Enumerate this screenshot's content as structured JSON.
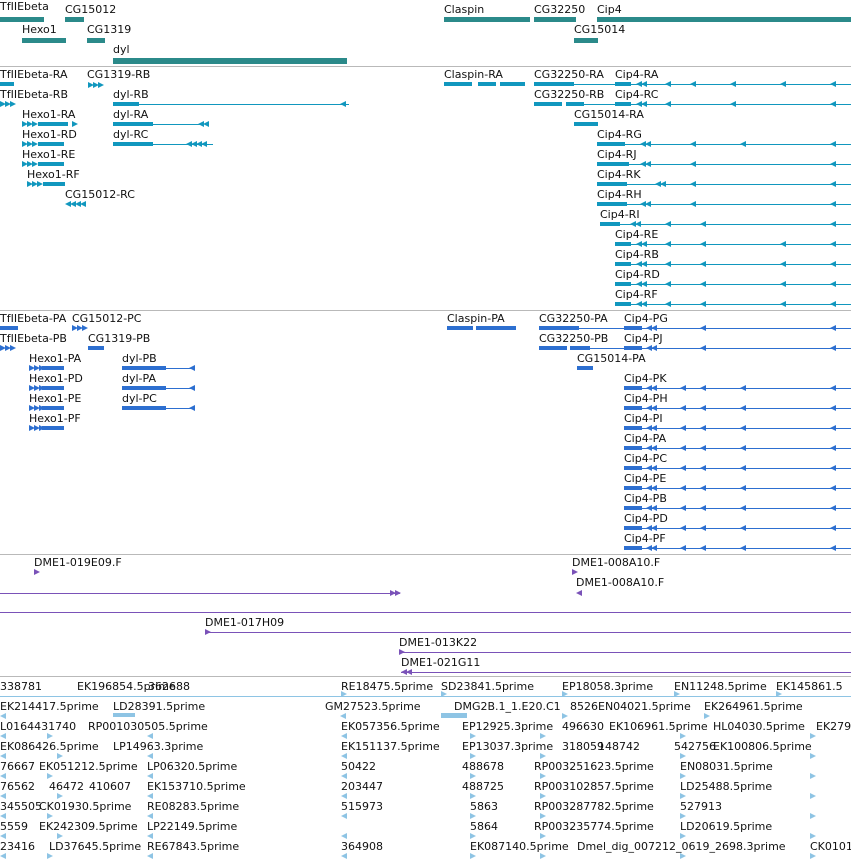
{
  "colors": {
    "gene": "#2b8a8a",
    "transcript": "#1197be",
    "protein": "#2d6fd0",
    "clone": "#7a52b8",
    "est": "#8ec4e4",
    "separator": "#b9b9b9"
  },
  "tracks": {
    "genes": {
      "name": "genes-track",
      "labels": [
        "TfIIEbeta",
        "CG15012",
        "Claspin",
        "CG32250",
        "Cip4",
        "Hexo1",
        "CG1319",
        "CG15014",
        "dyl"
      ]
    },
    "transcripts": {
      "name": "transcripts-track",
      "labels": [
        "TfIIEbeta-RA",
        "CG1319-RB",
        "Claspin-RA",
        "CG32250-RA",
        "Cip4-RA",
        "TfIIEbeta-RB",
        "dyl-RB",
        "CG32250-RB",
        "Cip4-RC",
        "Hexo1-RA",
        "dyl-RA",
        "CG15014-RA",
        "Hexo1-RD",
        "dyl-RC",
        "Cip4-RG",
        "Hexo1-RE",
        "Cip4-RJ",
        "Hexo1-RF",
        "Cip4-RK",
        "CG15012-RC",
        "Cip4-RH",
        "Cip4-RI",
        "Cip4-RE",
        "Cip4-RB",
        "Cip4-RD",
        "Cip4-RF"
      ]
    },
    "proteins": {
      "name": "proteins-track",
      "labels": [
        "TfIIEbeta-PA",
        "CG15012-PC",
        "Claspin-PA",
        "CG32250-PA",
        "Cip4-PG",
        "TfIIEbeta-PB",
        "CG1319-PB",
        "CG32250-PB",
        "Cip4-PJ",
        "CG15014-PA",
        "Hexo1-PA",
        "dyl-PB",
        "Hexo1-PD",
        "dyl-PA",
        "Hexo1-PE",
        "dyl-PC",
        "Hexo1-PF",
        "Cip4-PK",
        "Cip4-PH",
        "Cip4-PI",
        "Cip4-PA",
        "Cip4-PC",
        "Cip4-PE",
        "Cip4-PB",
        "Cip4-PD",
        "Cip4-PF"
      ]
    },
    "clones": {
      "name": "clones-track",
      "labels": [
        "DME1-019E09.F",
        "DME1-008A10.F",
        "DME1-008A10.F",
        "DME1-017H09",
        "DME1-013K22",
        "DME1-021G11"
      ]
    },
    "ests": {
      "name": "ests-track",
      "labels": [
        "338781",
        "EK196854.5prime",
        "362688",
        "RE18475.5prime",
        "SD23841.5prime",
        "EP18058.3prime",
        "EN11248.5prime",
        "EK145861.5",
        "EK214417.5prime",
        "LD28391.5prime",
        "GM27523.5prime",
        "DMG2B.1_1.E20.C1",
        "8526",
        "EN04021.5prime",
        "EK264961.5prime",
        "L0164431740",
        "RP001030505.5prime",
        "EK057356.5prime",
        "EP12925.3prime",
        "496630",
        "EK106961.5prime",
        "HL04030.5prime",
        "EK279",
        "EK086426.5prime",
        "LP14963.3prime",
        "EK151137.5prime",
        "EP13037.3prime",
        "318059",
        "148742",
        "542756",
        "EK100806.5prime",
        "76667",
        "EK051212.5prime",
        "LP06320.5prime",
        "50422",
        "488678",
        "RP003251623.5prime",
        "EN08031.5prime",
        "76562",
        "46472",
        "410607",
        "EK153710.5prime",
        "203447",
        "488725",
        "RP003102857.5prime",
        "LD25488.5prime",
        "345505",
        "CK01930.5prime",
        "RE08283.5prime",
        "515973",
        "5863",
        "RP003287782.5prime",
        "527913",
        "5559",
        "EK242309.5prime",
        "LP22149.5prime",
        "5864",
        "RP003235774.5prime",
        "LD20619.5prime",
        "23416",
        "LD37645.5prime",
        "RE67843.5prime",
        "364908",
        "EK087140.5prime",
        "Dmel_dig_007212_0619_2698.3prime",
        "CK0101"
      ]
    }
  }
}
